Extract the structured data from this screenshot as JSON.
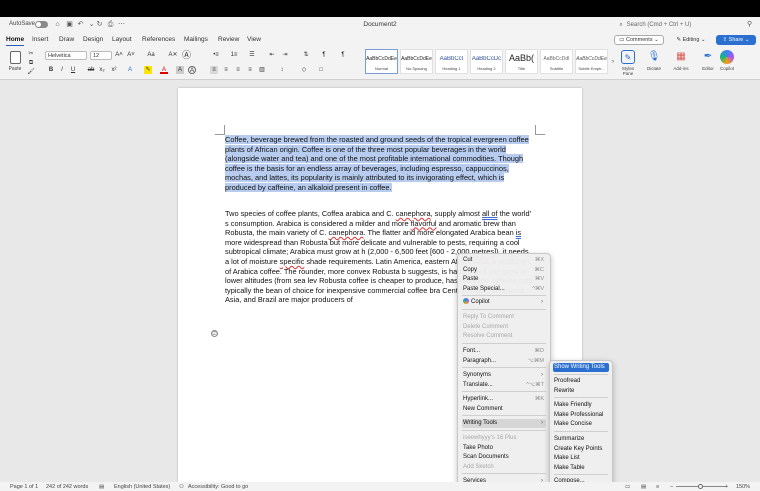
{
  "titlebar": {
    "autosave_label": "AutoSave",
    "document_title": "Document2",
    "search_placeholder": "Search (Cmd + Ctrl + U)"
  },
  "tabs": [
    "Home",
    "Insert",
    "Draw",
    "Design",
    "Layout",
    "References",
    "Mailings",
    "Review",
    "View"
  ],
  "active_tab": "Home",
  "header_buttons": {
    "comments": "Comments",
    "editing": "Editing",
    "share": "Share"
  },
  "ribbon": {
    "paste": "Paste",
    "font_name": "Helvetica",
    "font_size": "12",
    "grow_font": "A˄",
    "shrink_font": "A˅",
    "change_case": "Aa",
    "clear_formatting": "A✕",
    "bold": "B",
    "italic": "I",
    "underline": "U",
    "strikethrough": "ab",
    "subscript": "x₂",
    "superscript": "x²",
    "text_effects": "A",
    "highlight": "✎",
    "font_color": "A",
    "char_shading": "A",
    "char_border": "A",
    "bullets": "•≡",
    "numbering": "1≡",
    "multilevel": "☰",
    "decrease_indent": "⇤",
    "increase_indent": "⇥",
    "sort": "⇅",
    "show_marks": "¶",
    "align_left": "≡",
    "align_center": "≡",
    "align_right": "≡",
    "justify": "≡",
    "line_spacing": "↕",
    "shading": "◇",
    "borders": "□",
    "styles": [
      {
        "sample": "AaBbCcDdEe",
        "name": "Normal",
        "selected": true
      },
      {
        "sample": "AaBbCcDdEe",
        "name": "No Spacing"
      },
      {
        "sample": "AaBbCcI",
        "name": "Heading 1"
      },
      {
        "sample": "AaBbCcDc",
        "name": "Heading 2"
      },
      {
        "sample": "AaBb(",
        "name": "Title"
      },
      {
        "sample": "AaBbCcDdI",
        "name": "Subtitle"
      },
      {
        "sample": "AaBbCcDdEe",
        "name": "Subtle Emph..."
      }
    ],
    "styles_pane": "Styles Pane",
    "dictate": "Dictate",
    "addins": "Add-ins",
    "editor": "Editor",
    "copilot": "Copilot"
  },
  "document": {
    "para1": "Coffee, beverage brewed from the roasted and ground seeds of the tropical evergreen coffee plants of African origin. Coffee is one of the three most popular beverages in the world (alongside water and tea) and one of the most profitable international commodities. Though coffee is the basis for an endless array of beverages, including espresso, cappuccinos, mochas, and lattes, its popularity is mainly attributed to its invigorating effect, which is produced by caffeine, an alkaloid present in coffee.",
    "p2": {
      "a": "Two species of coffee plants, Coffea arabica and C. ",
      "sp1": "canephora",
      "b": ", supply almost ",
      "gr1": "all of",
      "c": " the world’ s consumption. Arabica is considered a milder and more ",
      "sp2": "flavorful",
      "d": " and aromatic brew than Robusta, the main variety of C. ",
      "sp3": "canephora",
      "e": ". The flatter and more elongated Arabica bean ",
      "gr2": "is",
      "f": " more widespread than Robusta but more delicate and vulnerable to pests, requiring a cool subtropical climate; Arabica must grow at h",
      "g": " (2,000 - 6,500 feet [600 - 2,000 ",
      "sp4": "metres",
      "h": "]), it needs a lot of moisture",
      "i": " ",
      "sp5": "specific",
      "j": " shade requirements. Latin America, eastern Africa, Asia, a",
      "k": " producers of Arabica coffee. The rounder, more convex Robusta b",
      "l": " suggests, is hardier and can grow at lower altitudes (from sea lev",
      "m": " Robusta coffee is cheaper to produce, has twice the caffeine cont",
      "n": " typically the bean of choice for inexpensive commercial coffee bra",
      "o": " Central Africa, Southeast Asia, and Brazil are major producers of"
    }
  },
  "context_menu": {
    "cut": "Cut",
    "cut_sc": "⌘X",
    "copy": "Copy",
    "copy_sc": "⌘C",
    "paste": "Paste",
    "paste_sc": "⌘V",
    "paste_special": "Paste Special...",
    "paste_special_sc": "^⌘V",
    "copilot": "Copilot",
    "reply_comment": "Reply To Comment",
    "delete_comment": "Delete Comment",
    "resolve_comment": "Resolve Comment",
    "font": "Font...",
    "font_sc": "⌘D",
    "paragraph": "Paragraph...",
    "paragraph_sc": "⌥⌘M",
    "synonyms": "Synonyms",
    "translate": "Translate...",
    "translate_sc": "^⌥⌘T",
    "hyperlink": "Hyperlink...",
    "hyperlink_sc": "⌘K",
    "new_comment": "New Comment",
    "writing_tools": "Writing Tools",
    "device": "iseewhyyy's 16 Plus",
    "take_photo": "Take Photo",
    "scan_documents": "Scan Documents",
    "add_sketch": "Add Sketch",
    "services": "Services"
  },
  "writing_tools_menu": {
    "show": "Show Writing Tools",
    "proofread": "Proofread",
    "rewrite": "Rewrite",
    "friendly": "Make Friendly",
    "professional": "Make Professional",
    "concise": "Make Concise",
    "summarize": "Summarize",
    "key_points": "Create Key Points",
    "list": "Make List",
    "table": "Make Table",
    "compose": "Compose..."
  },
  "statusbar": {
    "page": "Page 1 of 1",
    "words": "242 of 242 words",
    "language": "English (United States)",
    "accessibility": "Accessibility: Good to go",
    "zoom": "150%"
  },
  "colors": {
    "accent": "#2b6fd0",
    "selection": "#b7ccef"
  }
}
